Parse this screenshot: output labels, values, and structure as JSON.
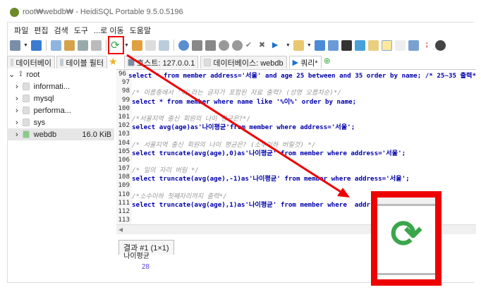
{
  "window": {
    "title": "root₩webdb₩ - HeidiSQL Portable 9.5.0.5196",
    "logo": "HS"
  },
  "menu": [
    "파일",
    "편집",
    "검색",
    "도구",
    "...로 이동",
    "도움말"
  ],
  "left_tabs": [
    "데이터베이",
    "테이블 필터"
  ],
  "query_tabs": [
    {
      "label": "호스트: 127.0.0.1",
      "icon": "host-icon"
    },
    {
      "label": "데이터베이스: webdb",
      "icon": "database-icon"
    },
    {
      "label": "쿼리*",
      "icon": "play-icon"
    }
  ],
  "tree": {
    "root": "root",
    "items": [
      {
        "label": "informati..."
      },
      {
        "label": "mysql"
      },
      {
        "label": "performa..."
      },
      {
        "label": "sys"
      },
      {
        "label": "webdb",
        "size": "16.0 KiB"
      }
    ]
  },
  "editor": {
    "lines": [
      {
        "n": "96",
        "text": "select * from member address='서울' and age 25 between and 35 order by name; /* 25~35 출력*",
        "comment": false
      },
      {
        "n": "97",
        "text": "",
        "comment": false
      },
      {
        "n": "98",
        "text": "/* 이름중에서 '이'라는 글자가 포함된 자료 출력? (성명 오름차순)*/",
        "comment": true
      },
      {
        "n": "99",
        "text": "select * from member where name like '%이%' order by name;",
        "comment": false
      },
      {
        "n": "100",
        "text": "",
        "comment": false
      },
      {
        "n": "101",
        "text": "/*서울지역 출신 회원의 나이 평균은?*/",
        "comment": true
      },
      {
        "n": "102",
        "text": "select avg(age)as'나이평균'from member where address='서울';",
        "comment": false
      },
      {
        "n": "103",
        "text": "",
        "comment": false
      },
      {
        "n": "104",
        "text": "/* 서울지역 출신 회원의 나이 평균은? (소수이하 버릴것) */",
        "comment": true
      },
      {
        "n": "105",
        "text": "select truncate(avg(age),0)as'나이평균' from member where address='서울';",
        "comment": false
      },
      {
        "n": "106",
        "text": "",
        "comment": false
      },
      {
        "n": "107",
        "text": "/* 일의 자리 버림 */",
        "comment": true
      },
      {
        "n": "108",
        "text": "select truncate(avg(age),-1)as'나이평균' from member where address='서울';",
        "comment": false
      },
      {
        "n": "109",
        "text": "",
        "comment": false
      },
      {
        "n": "110",
        "text": "/*소수이하 첫째자리까지 출력*/",
        "comment": true
      },
      {
        "n": "111",
        "text": "select truncate(avg(age),1)as'나이평균' from member where  addr",
        "comment": false
      },
      {
        "n": "112",
        "text": "",
        "comment": false
      },
      {
        "n": "113",
        "text": "",
        "comment": false
      }
    ]
  },
  "results": {
    "tab": "결과 #1 (1×1)",
    "columns": [
      "나이평균"
    ],
    "rows": [
      [
        "28"
      ]
    ]
  },
  "colors": {
    "highlight": "#e00000",
    "refresh": "#3aa64a"
  }
}
